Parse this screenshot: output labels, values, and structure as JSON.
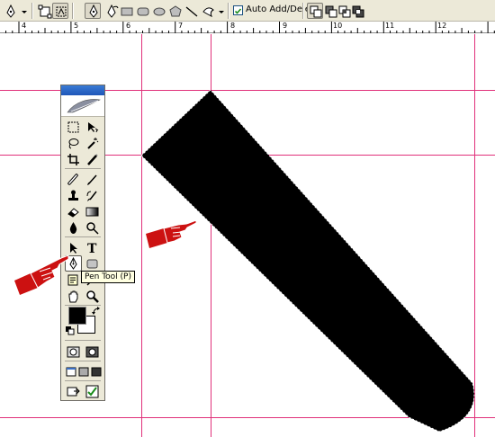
{
  "options_bar": {
    "tool_preset_icon": "pen-icon",
    "mode_buttons": [
      "shape-layers-icon",
      "paths-icon"
    ],
    "draw_tools": [
      "pen-icon",
      "freeform-pen-icon",
      "rectangle-icon",
      "rounded-rectangle-icon",
      "ellipse-icon",
      "polygon-icon",
      "line-icon",
      "custom-shape-icon"
    ],
    "auto_add_delete": {
      "label": "Auto Add/Delete",
      "checked": true
    },
    "path_operations": [
      "add-to-area-icon",
      "subtract-icon",
      "intersect-icon",
      "exclude-icon"
    ]
  },
  "ruler": {
    "labels": [
      "4",
      "5",
      "6",
      "7",
      "8",
      "9",
      "10",
      "11",
      "12"
    ]
  },
  "tools_panel": {
    "tools": [
      [
        "marquee-icon",
        "move-icon"
      ],
      [
        "lasso-icon",
        "magic-wand-icon"
      ],
      [
        "crop-icon",
        "slice-icon"
      ],
      [
        "healing-brush-icon",
        "brush-icon"
      ],
      [
        "clone-stamp-icon",
        "history-brush-icon"
      ],
      [
        "eraser-icon",
        "gradient-icon"
      ],
      [
        "blur-icon",
        "dodge-icon"
      ],
      [
        "path-selection-icon",
        "type-icon"
      ],
      [
        "pen-icon",
        "rectangle-shape-icon"
      ],
      [
        "notes-icon",
        "eyedropper-icon"
      ],
      [
        "hand-icon",
        "zoom-icon"
      ]
    ],
    "active_tool": "pen-icon",
    "foreground_color": "#000000",
    "background_color": "#ffffff"
  },
  "tooltip": {
    "text": "Pen Tool (P)"
  },
  "colors": {
    "guide": "#e0307a",
    "shape_fill": "#000000",
    "pointer_hand": "#cc1111",
    "panel_bg": "#ece9d8"
  }
}
